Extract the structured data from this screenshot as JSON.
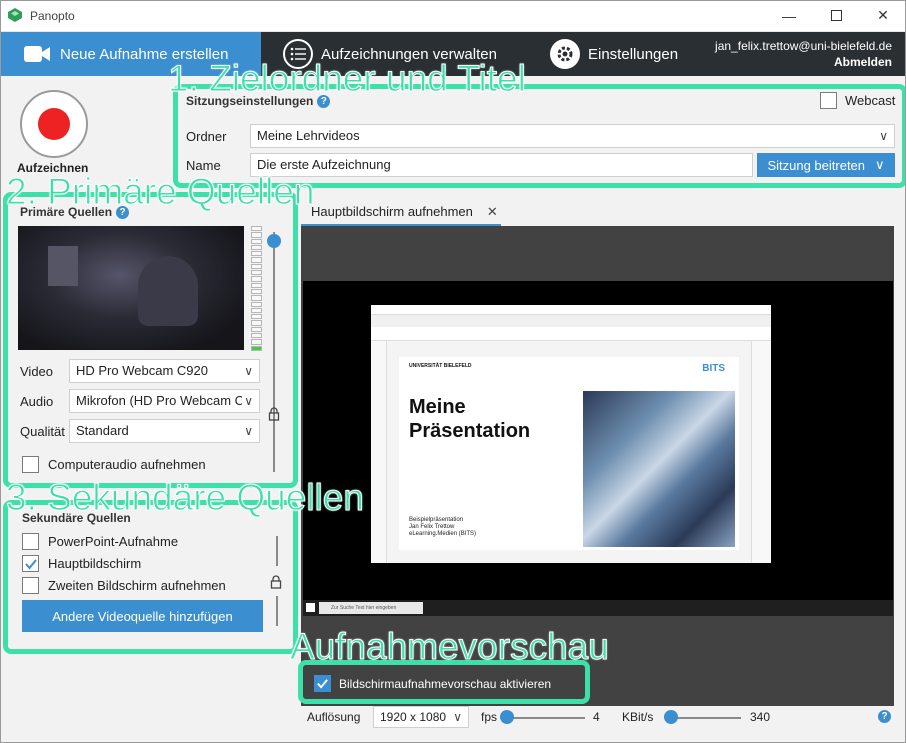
{
  "window": {
    "title": "Panopto"
  },
  "nav": {
    "tabs": [
      {
        "label": "Neue Aufnahme erstellen",
        "icon": "camera-icon"
      },
      {
        "label": "Aufzeichnungen verwalten",
        "icon": "list-icon"
      },
      {
        "label": "Einstellungen",
        "icon": "gear-icon"
      }
    ],
    "user": "jan_felix.trettow@uni-bielefeld.de",
    "logout": "Abmelden"
  },
  "record": {
    "label": "Aufzeichnen"
  },
  "session": {
    "title": "Sitzungseinstellungen",
    "webcast_label": "Webcast",
    "folder_label": "Ordner",
    "folder_value": "Meine Lehrvideos",
    "name_label": "Name",
    "name_value": "Die erste Aufzeichnung",
    "join_button": "Sitzung beitreten"
  },
  "primary": {
    "title": "Primäre Quellen",
    "video_label": "Video",
    "video_value": "HD Pro Webcam C920",
    "audio_label": "Audio",
    "audio_value": "Mikrofon (HD Pro Webcam C",
    "quality_label": "Qualität",
    "quality_value": "Standard",
    "computer_audio_label": "Computeraudio aufnehmen"
  },
  "secondary": {
    "title": "Sekundäre Quellen",
    "items": [
      {
        "label": "PowerPoint-Aufnahme",
        "checked": false
      },
      {
        "label": "Hauptbildschirm",
        "checked": true
      },
      {
        "label": "Zweiten Bildschirm aufnehmen",
        "checked": false
      }
    ],
    "add_button": "Andere Videoquelle hinzufügen"
  },
  "preview": {
    "tab_label": "Hauptbildschirm aufnehmen",
    "enable_label": "Bildschirmaufnahmevorschau aktivieren",
    "slide": {
      "university": "UNIVERSITÄT BIELEFELD",
      "logo": "BITS",
      "title_line1": "Meine",
      "title_line2": "Präsentation",
      "footer_line1": "Beispielpräsentation",
      "footer_line2": "Jan Felix Trettow",
      "footer_line3": "eLearning.Medien (BITS)"
    },
    "taskbar_search": "Zur Suche Text hier eingeben"
  },
  "bottom": {
    "resolution_label": "Auflösung",
    "resolution_value": "1920 x 1080",
    "fps_label": "fps",
    "fps_value": "4",
    "kbit_label": "KBit/s",
    "kbit_value": "340",
    "fps_level": 0.0,
    "kbit_level": 0.0
  },
  "annotations": {
    "a1": "1. Zielordner und Titel",
    "a2": "2. Primäre Quellen",
    "a3": "3. Sekundäre Quellen",
    "a4": "Aufnahmevorschau"
  },
  "colors": {
    "accent": "#3b8ecf",
    "nav": "#2a2f33",
    "record": "#ee2222",
    "highlight": "#3de0a8"
  }
}
